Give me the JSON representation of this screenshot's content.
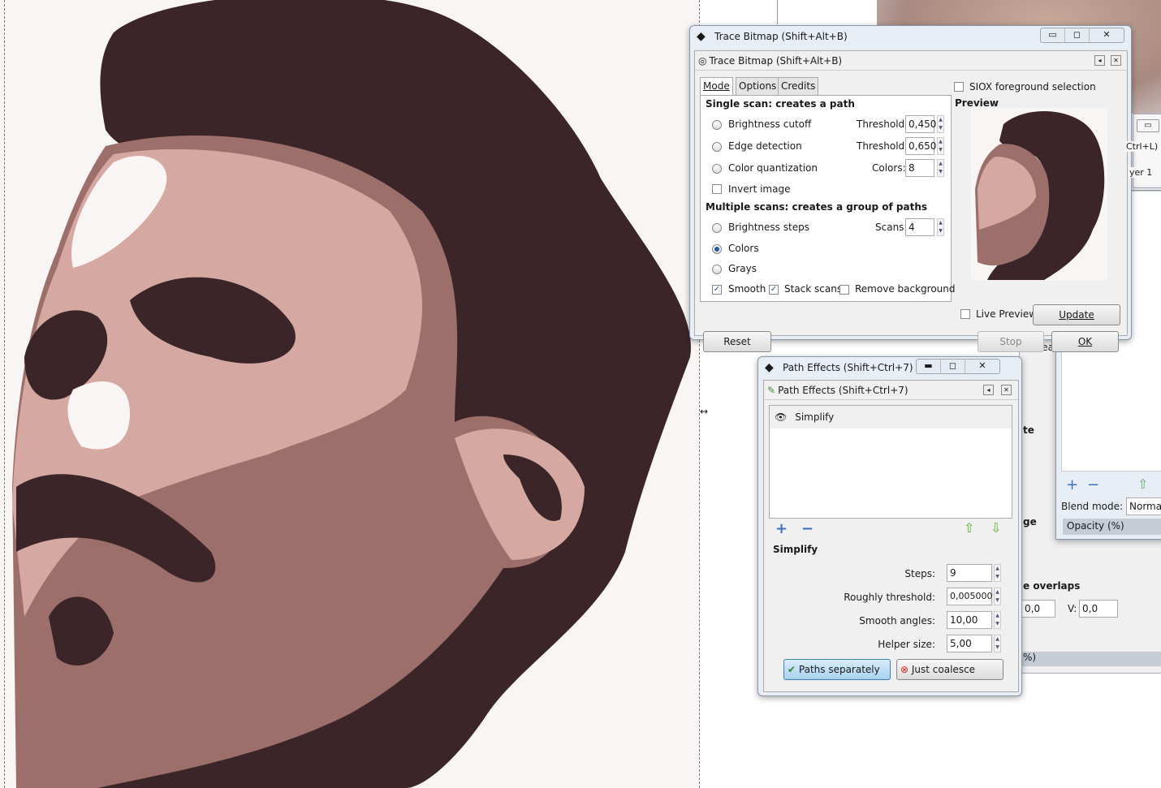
{
  "trace_window": {
    "title": "Trace Bitmap (Shift+Alt+B)",
    "dock_title": "Trace Bitmap (Shift+Alt+B)",
    "tabs": [
      "Mode",
      "Options",
      "Credits"
    ],
    "single_scan_heading": "Single scan: creates a path",
    "brightness_cutoff": "Brightness cutoff",
    "threshold_label": "Threshold:",
    "brightness_threshold": "0,450",
    "edge_detection": "Edge detection",
    "edge_threshold": "0,650",
    "color_quantization": "Color quantization",
    "colors_label": "Colors:",
    "colors_value": "8",
    "invert_image": "Invert image",
    "multiple_scans_heading": "Multiple scans: creates a group of paths",
    "brightness_steps": "Brightness steps",
    "scans_label": "Scans:",
    "scans_value": "4",
    "colors_option": "Colors",
    "grays_option": "Grays",
    "selected_mode": "Colors",
    "smooth": "Smooth",
    "smooth_checked": true,
    "stack_scans": "Stack scans",
    "stack_checked": true,
    "remove_background": "Remove background",
    "remove_background_checked": false,
    "siox": "SIOX foreground selection",
    "preview_heading": "Preview",
    "live_preview": "Live Preview",
    "update": "Update",
    "reset": "Reset",
    "stop": "Stop",
    "ok": "OK"
  },
  "path_effects_window": {
    "title": "Path Effects  (Shift+Ctrl+7)",
    "dock_title": "Path Effects  (Shift+Ctrl+7)",
    "effects": [
      "Simplify"
    ],
    "section_heading": "Simplify",
    "steps_label": "Steps:",
    "steps": "9",
    "threshold_label": "Roughly threshold:",
    "threshold": "0,005000",
    "smooth_label": "Smooth angles:",
    "smooth": "10,00",
    "helper_label": "Helper size:",
    "helper": "5,00",
    "paths_separately": "Paths separately",
    "just_coalesce": "Just coalesce"
  },
  "background_panels": {
    "shortcut_fragment": "Ctrl+L)",
    "layer_fragment": "yer 1",
    "trea_fragment": "Trea",
    "te_fragment": "te",
    "ge_fragment": "ge",
    "blend_mode_label": "Blend mode:",
    "blend_mode": "Normal",
    "opacity_label": "Opacity (%)",
    "overlaps_fragment": "e overlaps",
    "h_value": "0,0",
    "v_label": "V:",
    "v_value": "0,0",
    "percent_fragment": "%)"
  },
  "colors": {
    "dark": "#3b2529",
    "mid": "#9c6f6a",
    "light": "#d5a9a2",
    "paper": "#faf5f5"
  }
}
